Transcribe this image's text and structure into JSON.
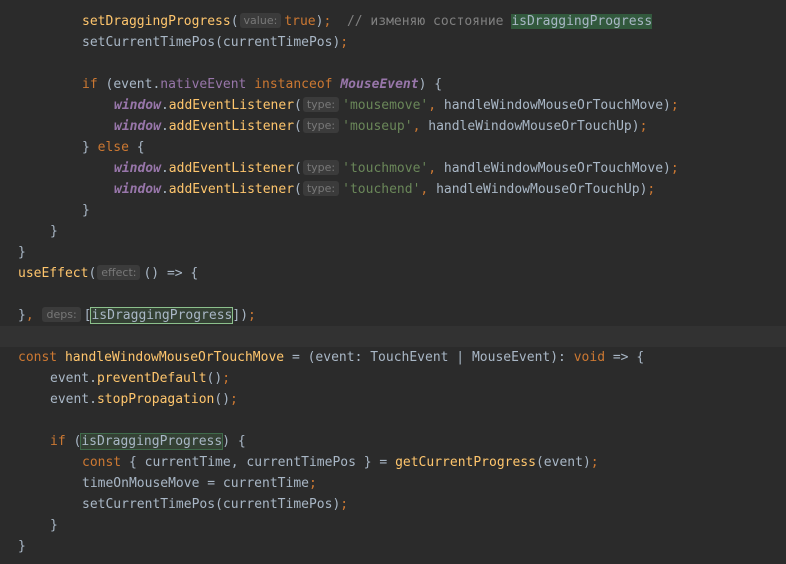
{
  "hints": {
    "value": "value:",
    "type": "type:",
    "effect": "effect:",
    "deps": "deps:"
  },
  "code": {
    "set_dragging": "setDraggingProgress",
    "true_kw": "true",
    "comment_text": "// изменяю состояние ",
    "comment_var": "isDraggingProgress",
    "set_current_time_pos": "setCurrentTimePos",
    "current_time_pos": "currentTimePos",
    "if_kw": "if",
    "event": "event",
    "native_event": "nativeEvent",
    "instanceof_kw": "instanceof",
    "mouse_event_cls": "MouseEvent",
    "window": "window",
    "add_event_listener": "addEventListener",
    "mousemove": "'mousemove'",
    "mouseup": "'mouseup'",
    "touchmove": "'touchmove'",
    "touchend": "'touchend'",
    "handle_move": "handleWindowMouseOrTouchMove",
    "handle_up": "handleWindowMouseOrTouchUp",
    "else_kw": "else",
    "use_effect": "useEffect",
    "dep_var": "isDraggingProgress",
    "const_kw": "const",
    "handle_move_decl": "handleWindowMouseOrTouchMove",
    "signature_params": " = (event: TouchEvent | MouseEvent): ",
    "void_kw": "void",
    "prevent_default": "preventDefault",
    "stop_propagation": "stopPropagation",
    "if_var": "isDraggingProgress",
    "destructure": "{ currentTime, currentTimePos } = ",
    "get_current_progress": "getCurrentProgress",
    "time_on_mouse_move": "timeOnMouseMove = currentTime",
    "current_time_pos_arg": "currentTimePos"
  }
}
